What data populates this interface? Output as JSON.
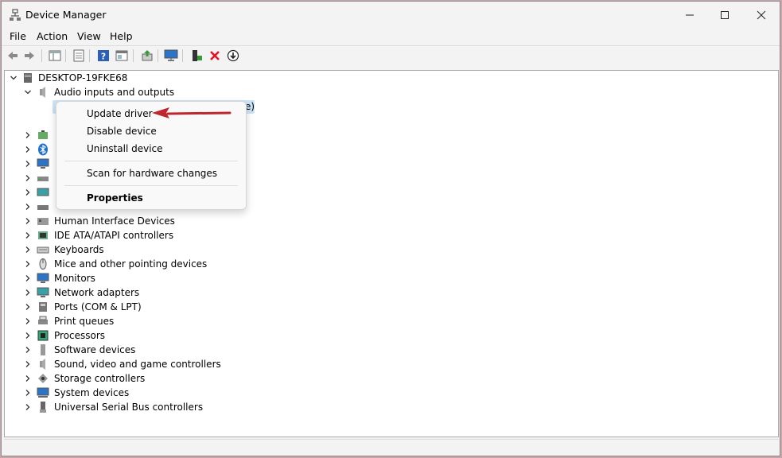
{
  "window": {
    "title": "Device Manager"
  },
  "menu": [
    "File",
    "Action",
    "View",
    "Help"
  ],
  "toolbar": {
    "buttons": [
      "back-icon",
      "forward-icon",
      "show-hide-tree-icon",
      "properties-icon",
      "help-icon",
      "console-view-icon",
      "update-driver-icon",
      "scan-hardware-icon",
      "add-driver-icon",
      "uninstall-icon",
      "download-icon"
    ]
  },
  "tree": {
    "root": "DESKTOP-19FKE68",
    "expanded": "Audio inputs and outputs",
    "child_partial": "e)",
    "categories": [
      "Human Interface Devices",
      "IDE ATA/ATAPI controllers",
      "Keyboards",
      "Mice and other pointing devices",
      "Monitors",
      "Network adapters",
      "Ports (COM & LPT)",
      "Print queues",
      "Processors",
      "Software devices",
      "Sound, video and game controllers",
      "Storage controllers",
      "System devices",
      "Universal Serial Bus controllers"
    ]
  },
  "context_menu": {
    "update": "Update driver",
    "disable": "Disable device",
    "uninstall": "Uninstall device",
    "scan": "Scan for hardware changes",
    "properties": "Properties"
  },
  "colors": {
    "accent_arrow": "#c0262d",
    "selection": "#cce4f7",
    "error_x": "#e81123"
  }
}
